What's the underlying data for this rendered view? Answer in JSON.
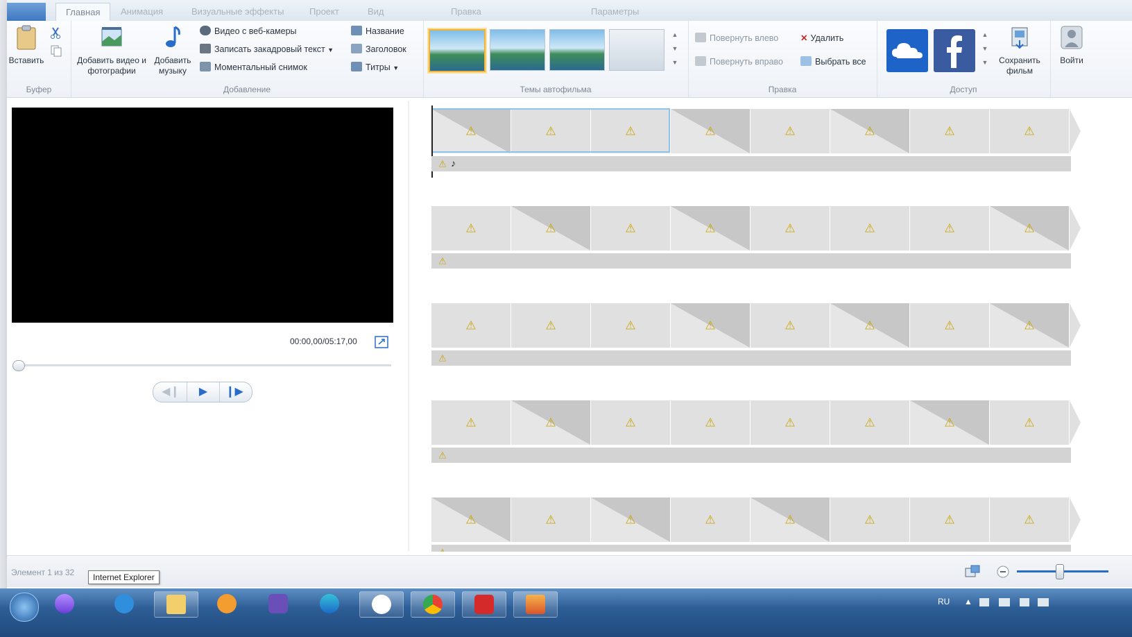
{
  "ribbon": {
    "tabs": [
      "Главная",
      "Анимация",
      "Визуальные эффекты",
      "Проект",
      "Вид",
      "Правка",
      "Параметры"
    ],
    "clipboard": {
      "paste": "Вставить",
      "group": "Буфер"
    },
    "add": {
      "add_video": "Добавить видео и фотографии",
      "add_music": "Добавить музыку",
      "webcam": "Видео с веб-камеры",
      "voiceover": "Записать закадровый текст",
      "snapshot": "Моментальный снимок",
      "title": "Название",
      "caption": "Заголовок",
      "credits": "Титры",
      "group": "Добавление"
    },
    "themes": {
      "group": "Темы автофильма"
    },
    "edit": {
      "rotate_left": "Повернуть влево",
      "rotate_right": "Повернуть вправо",
      "delete": "Удалить",
      "select_all": "Выбрать все",
      "group": "Правка"
    },
    "share": {
      "save_movie": "Сохранить фильм",
      "group": "Доступ"
    },
    "sign_in": "Войти"
  },
  "player": {
    "time": "00:00,00/05:17,00",
    "progress": 0
  },
  "status": {
    "items": "Элемент 1 из 32",
    "tooltip": "Internet Explorer"
  },
  "taskbar": {
    "lang": "RU"
  },
  "colors": {
    "accent": "#2a6cc9",
    "warning": "#c9a400",
    "selection": "#8fc3ea",
    "theme_selected": "#f0b43a"
  }
}
